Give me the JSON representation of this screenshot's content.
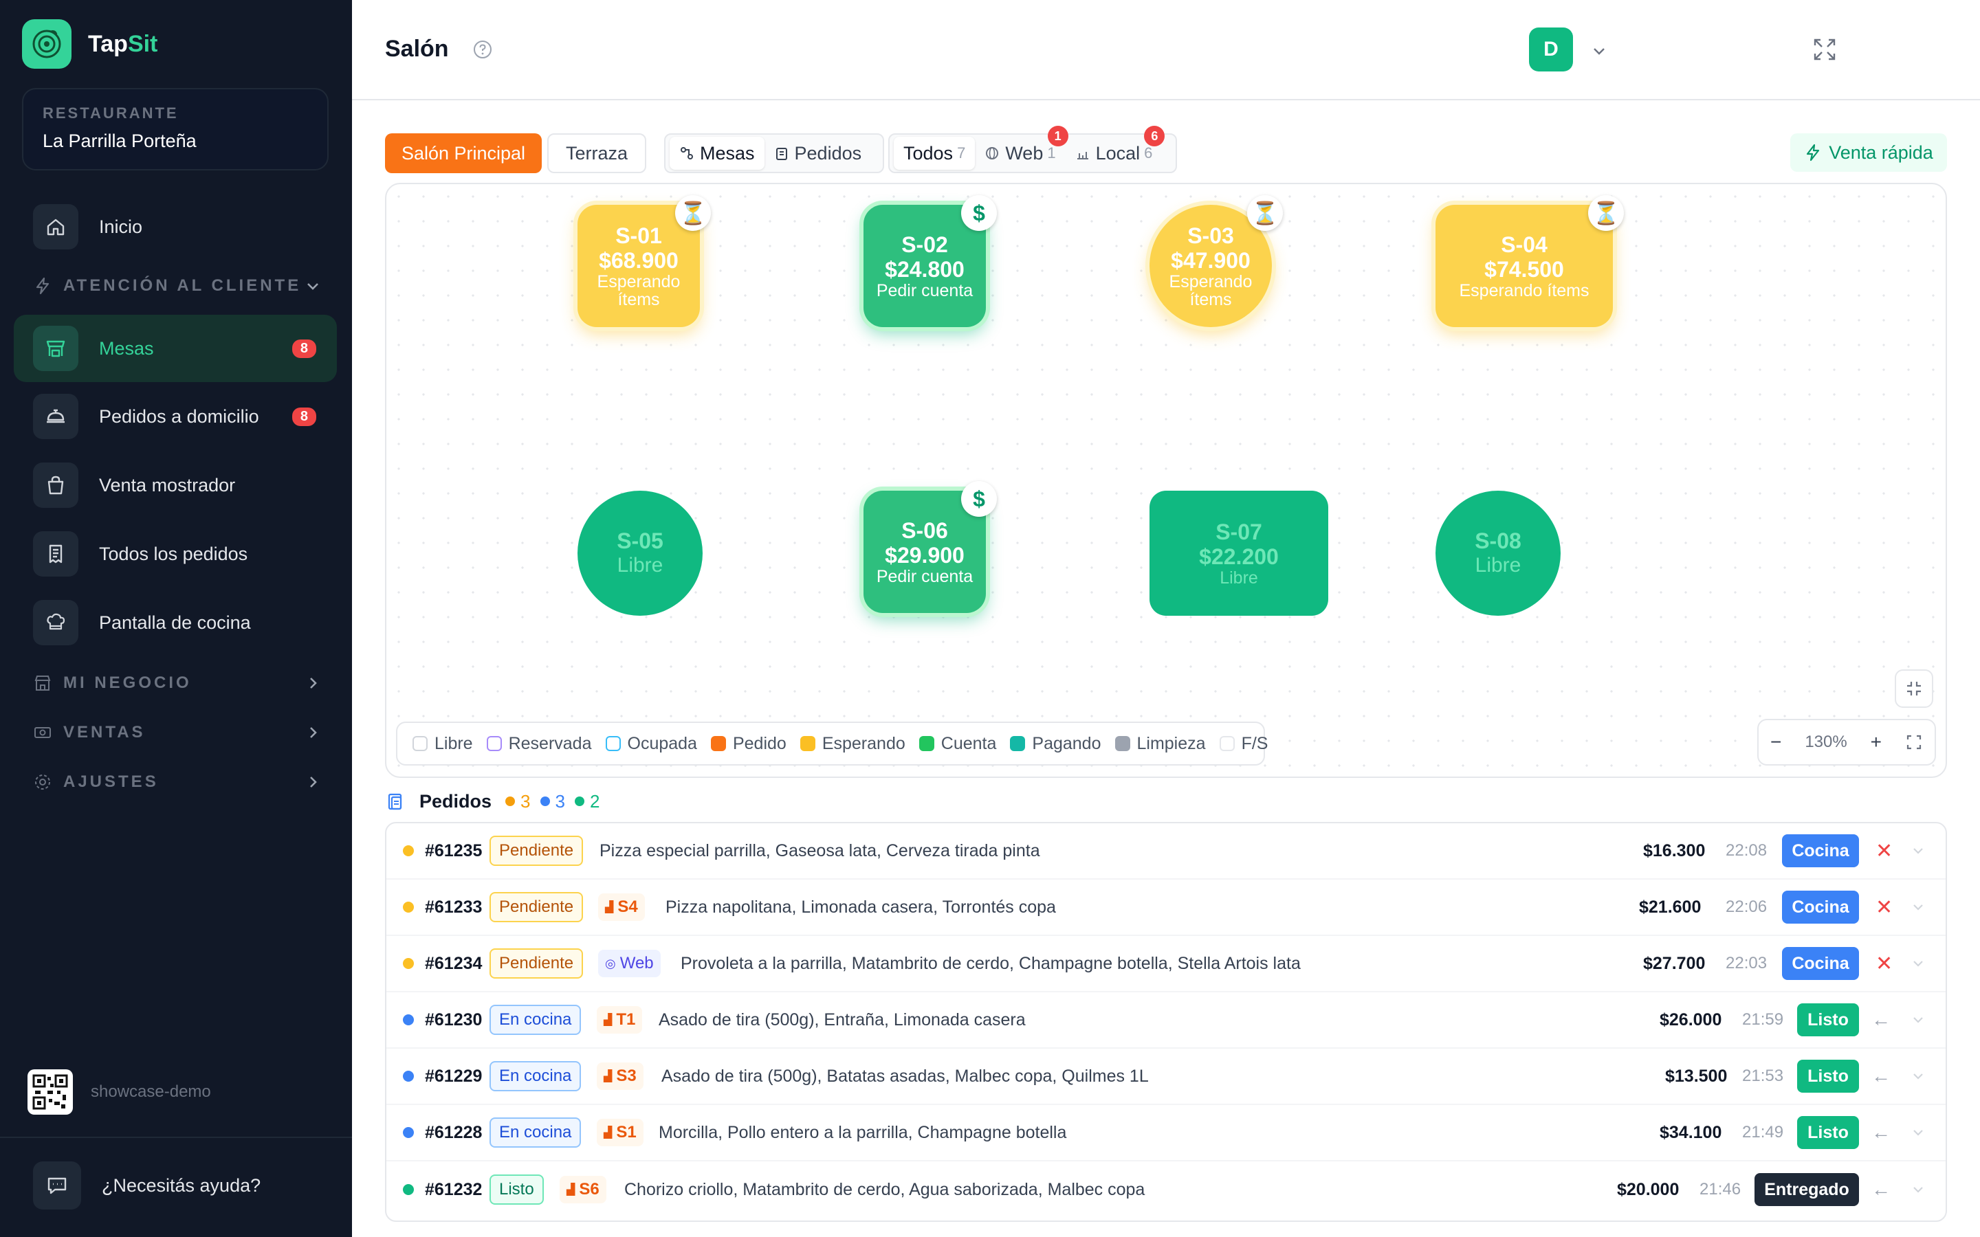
{
  "brand": {
    "name_part1": "Tap",
    "name_part2": "Sit"
  },
  "restaurant": {
    "label": "RESTAURANTE",
    "name": "La Parrilla Porteña"
  },
  "sidebar": {
    "home": "Inicio",
    "section_customer": "ATENCIÓN AL CLIENTE",
    "items": [
      {
        "label": "Mesas",
        "badge": "8",
        "icon": "table-icon"
      },
      {
        "label": "Pedidos a domicilio",
        "badge": "8",
        "icon": "delivery-icon"
      },
      {
        "label": "Venta mostrador",
        "icon": "bag-icon"
      },
      {
        "label": "Todos los pedidos",
        "icon": "receipt-icon"
      },
      {
        "label": "Pantalla de cocina",
        "icon": "chef-icon"
      }
    ],
    "section_business": "MI NEGOCIO",
    "section_sales": "VENTAS",
    "section_settings": "AJUSTES",
    "workspace": "showcase-demo",
    "help": "¿Necesitás ayuda?"
  },
  "header": {
    "title": "Salón",
    "avatar_initial": "D"
  },
  "toolbar": {
    "zone_main": "Salón Principal",
    "zone_terrace": "Terraza",
    "view_tables": "Mesas",
    "view_orders": "Pedidos",
    "filter_all": "Todos",
    "filter_all_count": "7",
    "filter_web": "Web",
    "filter_web_count": "1",
    "filter_web_badge": "1",
    "filter_local": "Local",
    "filter_local_count": "6",
    "filter_local_badge": "6",
    "quick_sale": "Venta rápida"
  },
  "tables": [
    {
      "id": "S-01",
      "amount": "$68.900",
      "status": "Esperando",
      "status2": "ítems",
      "state": "waiting",
      "badge": "hourglass-icon"
    },
    {
      "id": "S-02",
      "amount": "$24.800",
      "status": "Pedir cuenta",
      "state": "bill",
      "badge": "dollar-icon"
    },
    {
      "id": "S-03",
      "amount": "$47.900",
      "status": "Esperando",
      "status2": "ítems",
      "state": "waiting",
      "badge": "hourglass-icon"
    },
    {
      "id": "S-04",
      "amount": "$74.500",
      "status": "Esperando ítems",
      "state": "waiting",
      "badge": "hourglass-icon"
    },
    {
      "id": "S-05",
      "status": "Libre",
      "state": "free"
    },
    {
      "id": "S-06",
      "amount": "$29.900",
      "status": "Pedir cuenta",
      "state": "bill",
      "badge": "dollar-icon"
    },
    {
      "id": "S-07",
      "amount": "$22.200",
      "status": "Libre",
      "state": "free"
    },
    {
      "id": "S-08",
      "status": "Libre",
      "state": "free"
    }
  ],
  "legend": [
    {
      "label": "Libre",
      "color": "#ffffff",
      "border": "#d1d5db"
    },
    {
      "label": "Reservada",
      "color": "#ffffff",
      "border": "#a78bfa"
    },
    {
      "label": "Ocupada",
      "color": "#ffffff",
      "border": "#38bdf8"
    },
    {
      "label": "Pedido",
      "color": "#f97316",
      "border": "#f97316"
    },
    {
      "label": "Esperando",
      "color": "#fbbf24",
      "border": "#fbbf24"
    },
    {
      "label": "Cuenta",
      "color": "#22c55e",
      "border": "#22c55e"
    },
    {
      "label": "Pagando",
      "color": "#14b8a6",
      "border": "#14b8a6"
    },
    {
      "label": "Limpieza",
      "color": "#9ca3af",
      "border": "#9ca3af"
    },
    {
      "label": "F/S",
      "color": "#ffffff",
      "border": "#e5e7eb"
    }
  ],
  "zoom": {
    "minus": "−",
    "level": "130%",
    "plus": "+"
  },
  "orders": {
    "title": "Pedidos",
    "count_pending": "3",
    "count_cooking": "3",
    "count_ready": "2",
    "rows": [
      {
        "id": "#61235",
        "status": "Pendiente",
        "items": "Pizza especial parrilla, Gaseosa lata, Cerveza tirada pinta",
        "total": "$16.300",
        "time": "22:08",
        "action": "Cocina"
      },
      {
        "id": "#61233",
        "status": "Pendiente",
        "source": "S4",
        "items": "Pizza napolitana, Limonada casera, Torrontés copa",
        "total": "$21.600",
        "time": "22:06",
        "action": "Cocina"
      },
      {
        "id": "#61234",
        "status": "Pendiente",
        "source": "Web",
        "items": "Provoleta a la parrilla, Matambrito de cerdo, Champagne botella, Stella Artois lata",
        "total": "$27.700",
        "time": "22:03",
        "action": "Cocina"
      },
      {
        "id": "#61230",
        "status": "En cocina",
        "source": "T1",
        "items": "Asado de tira (500g), Entraña, Limonada casera",
        "total": "$26.000",
        "time": "21:59",
        "action": "Listo"
      },
      {
        "id": "#61229",
        "status": "En cocina",
        "source": "S3",
        "items": "Asado de tira (500g), Batatas asadas, Malbec copa, Quilmes 1L",
        "total": "$13.500",
        "time": "21:53",
        "action": "Listo"
      },
      {
        "id": "#61228",
        "status": "En cocina",
        "source": "S1",
        "items": "Morcilla, Pollo entero a la parrilla, Champagne botella",
        "total": "$34.100",
        "time": "21:49",
        "action": "Listo"
      },
      {
        "id": "#61232",
        "status": "Listo",
        "source": "S6",
        "items": "Chorizo criollo, Matambrito de cerdo, Agua saborizada, Malbec copa",
        "total": "$20.000",
        "time": "21:46",
        "action": "Entregado"
      }
    ]
  },
  "colors": {
    "accent": "#10b981",
    "orange": "#f97316",
    "danger": "#ef4444",
    "sidebar_bg": "#111827"
  }
}
